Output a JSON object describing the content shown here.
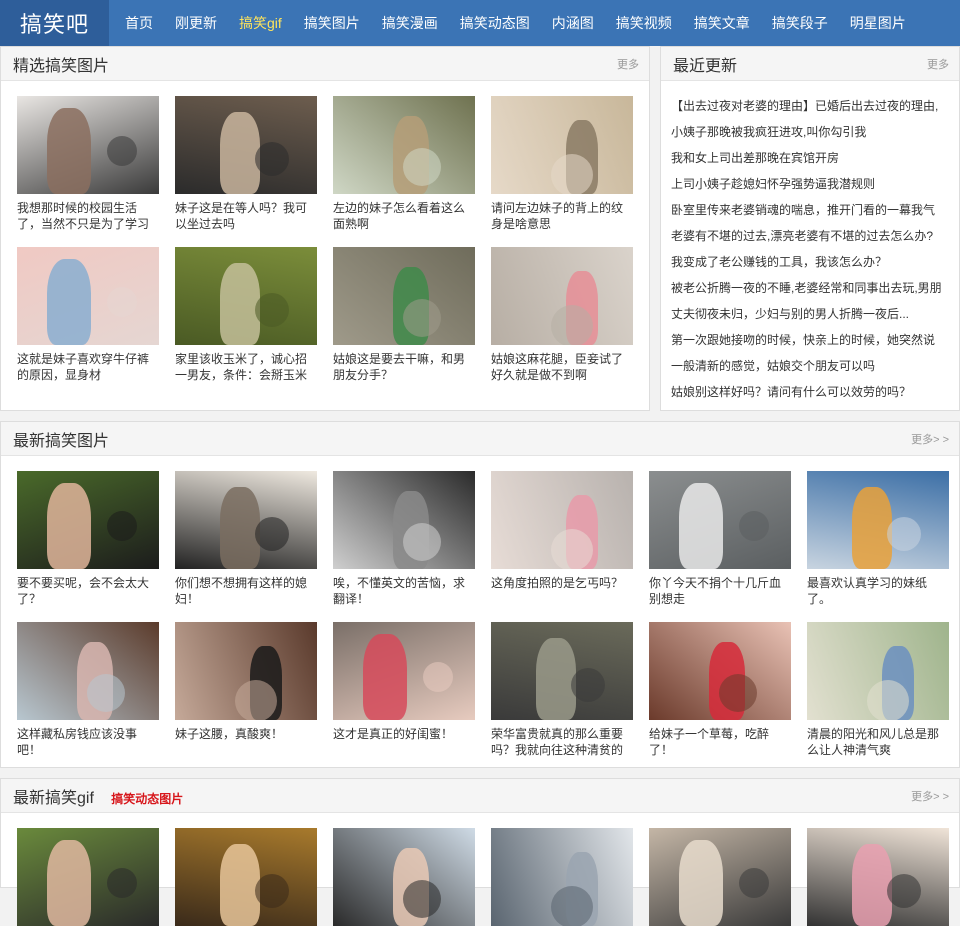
{
  "site": {
    "logo": "搞笑吧"
  },
  "nav": [
    "首页",
    "刚更新",
    "搞笑gif",
    "搞笑图片",
    "搞笑漫画",
    "搞笑动态图",
    "内涵图",
    "搞笑视频",
    "搞笑文章",
    "搞笑段子",
    "明星图片"
  ],
  "featured": {
    "title": "精选搞笑图片",
    "more": "更多",
    "items": [
      {
        "caption": "我想那时候的校园生活了，当然不只是为了学习",
        "colors": [
          "#e9e6e3",
          "#8b6f5f",
          "#3a3a3a"
        ]
      },
      {
        "caption": "妹子这是在等人吗？我可以坐过去吗",
        "colors": [
          "#6d5d4e",
          "#c9b59d",
          "#2b2b2b"
        ]
      },
      {
        "caption": "左边的妹子怎么看着这么面熟啊",
        "colors": [
          "#6f7250",
          "#b59e78",
          "#cfd7c5"
        ]
      },
      {
        "caption": "请问左边妹子的背上的纹身是啥意思",
        "colors": [
          "#c8b79a",
          "#8a7a64",
          "#e6d9c8"
        ]
      },
      {
        "caption": "这就是妹子喜欢穿牛仔裤的原因，显身材",
        "colors": [
          "#f0c9c3",
          "#8aaed0",
          "#e5d6d2"
        ]
      },
      {
        "caption": "家里该收玉米了，诚心招一男友，条件：会掰玉米",
        "colors": [
          "#7b8d3a",
          "#c4c09a",
          "#4a5a24"
        ]
      },
      {
        "caption": "姑娘这是要去干嘛，和男朋友分手？",
        "colors": [
          "#6f6c5b",
          "#3f8a4a",
          "#9f9a8a"
        ]
      },
      {
        "caption": "姑娘这麻花腿，臣妾试了好久就是做不到啊",
        "colors": [
          "#dad3cb",
          "#e68e97",
          "#b7aea4"
        ]
      }
    ]
  },
  "recent": {
    "title": "最近更新",
    "more": "更多",
    "items": [
      "【出去过夜对老婆的理由】已婚后出去过夜的理由,",
      "小姨子那晚被我疯狂进攻,叫你勾引我",
      "我和女上司出差那晚在宾馆开房",
      "上司小姨子趁媳妇怀孕强势逼我潜规则",
      "卧室里传来老婆销魂的喘息，推开门看的一幕我气",
      "老婆有不堪的过去,漂亮老婆有不堪的过去怎么办?",
      "我变成了老公赚钱的工具，我该怎么办？",
      "被老公折腾一夜的不睡,老婆经常和同事出去玩,男朋",
      "丈夫彻夜未归，少妇与别的男人折腾一夜后...",
      "第一次跟她接吻的时候，快亲上的时候，她突然说",
      "一般清新的感觉，姑娘交个朋友可以吗",
      "姑娘别这样好吗？请问有什么可以效劳的吗？"
    ]
  },
  "latest_pics": {
    "title": "最新搞笑图片",
    "more": "更多> >",
    "items": [
      {
        "caption": "要不要买呢，会不会太大了？",
        "colors": [
          "#4a6a2a",
          "#e0b59b",
          "#1c1c1c"
        ]
      },
      {
        "caption": "你们想不想拥有这样的媳妇！",
        "colors": [
          "#efe9e0",
          "#7a6d60",
          "#222"
        ]
      },
      {
        "caption": "唉，不懂英文的苦恼，求翻译！",
        "colors": [
          "#2b2b2b",
          "#8a8a8a",
          "#cfcfcf"
        ]
      },
      {
        "caption": "这角度拍照的是乞丐吗？",
        "colors": [
          "#b8b2ae",
          "#e79aa9",
          "#e7dcd6"
        ]
      },
      {
        "caption": "你丫今天不捐个十几斤血别想走",
        "colors": [
          "#8b8e8f",
          "#e9e9e9",
          "#5b5f61"
        ]
      },
      {
        "caption": "最喜欢认真学习的妹纸了。",
        "colors": [
          "#3c6fa6",
          "#e9a13a",
          "#c8d4e0"
        ]
      },
      {
        "caption": "这样藏私房钱应该没事吧！",
        "colors": [
          "#5b3b2b",
          "#d8b6b0",
          "#b8c7d0"
        ]
      },
      {
        "caption": "妹子这腰，真酸爽！",
        "colors": [
          "#5a3a2c",
          "#1a1a1a",
          "#c5a999"
        ]
      },
      {
        "caption": "这才是真正的好闺蜜！",
        "colors": [
          "#7a6f68",
          "#d64a5a",
          "#e7cbbf"
        ]
      },
      {
        "caption": "荣华富贵就真的那么重要吗？我就向往这种清贫的生",
        "colors": [
          "#6a6a5a",
          "#9a9a8a",
          "#3a3a3a"
        ]
      },
      {
        "caption": "给妹子一个草莓，吃醉了！",
        "colors": [
          "#e9c2b5",
          "#d62a3a",
          "#6b3a2b"
        ]
      },
      {
        "caption": "清晨的阳光和风儿总是那么让人神清气爽",
        "colors": [
          "#9fb48c",
          "#6b8fc0",
          "#e2e0d0"
        ]
      }
    ]
  },
  "latest_gif": {
    "title": "最新搞笑gif",
    "sub": "搞笑动态图片",
    "more": "更多> >",
    "items": [
      {
        "colors": [
          "#6a8a3c",
          "#e0b8a0",
          "#2a2a2a"
        ]
      },
      {
        "colors": [
          "#a87a2c",
          "#e8c59a",
          "#3a2a1a"
        ]
      },
      {
        "colors": [
          "#cfdbe6",
          "#e9c9b5",
          "#2a2a2a"
        ]
      },
      {
        "colors": [
          "#e2e6ea",
          "#9aa5b0",
          "#5a6570"
        ]
      },
      {
        "colors": [
          "#c4b6a6",
          "#e8dccc",
          "#3a3a3a"
        ]
      },
      {
        "colors": [
          "#f0e4d8",
          "#e9a0b0",
          "#333"
        ]
      }
    ]
  }
}
